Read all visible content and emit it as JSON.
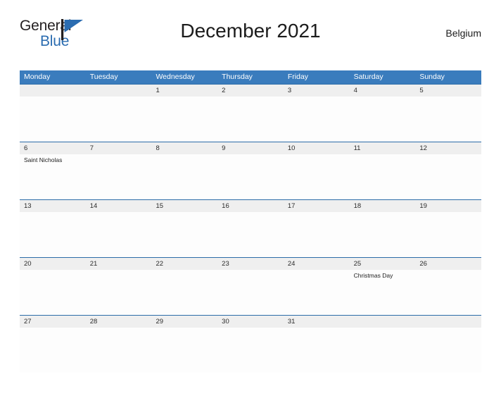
{
  "brand": {
    "name_part1": "General",
    "name_part2": "Blue",
    "mark_icon": "triangle-flag-icon",
    "mark_color": "#2b6cb0",
    "text_color": "#231f20"
  },
  "header": {
    "title": "December 2021",
    "region": "Belgium"
  },
  "colors": {
    "header_bar": "#3a7cbd",
    "date_band": "#efefef",
    "row_divider": "#2c6ca8",
    "accent_blue": "#2b6cb0",
    "text_dark": "#1c1c1c",
    "header_text": "#ffffff"
  },
  "calendar": {
    "weekdays": [
      "Monday",
      "Tuesday",
      "Wednesday",
      "Thursday",
      "Friday",
      "Saturday",
      "Sunday"
    ],
    "weeks": [
      {
        "days": [
          {
            "date": "",
            "event": ""
          },
          {
            "date": "",
            "event": ""
          },
          {
            "date": "1",
            "event": ""
          },
          {
            "date": "2",
            "event": ""
          },
          {
            "date": "3",
            "event": ""
          },
          {
            "date": "4",
            "event": ""
          },
          {
            "date": "5",
            "event": ""
          }
        ]
      },
      {
        "days": [
          {
            "date": "6",
            "event": "Saint Nicholas"
          },
          {
            "date": "7",
            "event": ""
          },
          {
            "date": "8",
            "event": ""
          },
          {
            "date": "9",
            "event": ""
          },
          {
            "date": "10",
            "event": ""
          },
          {
            "date": "11",
            "event": ""
          },
          {
            "date": "12",
            "event": ""
          }
        ]
      },
      {
        "days": [
          {
            "date": "13",
            "event": ""
          },
          {
            "date": "14",
            "event": ""
          },
          {
            "date": "15",
            "event": ""
          },
          {
            "date": "16",
            "event": ""
          },
          {
            "date": "17",
            "event": ""
          },
          {
            "date": "18",
            "event": ""
          },
          {
            "date": "19",
            "event": ""
          }
        ]
      },
      {
        "days": [
          {
            "date": "20",
            "event": ""
          },
          {
            "date": "21",
            "event": ""
          },
          {
            "date": "22",
            "event": ""
          },
          {
            "date": "23",
            "event": ""
          },
          {
            "date": "24",
            "event": ""
          },
          {
            "date": "25",
            "event": "Christmas Day"
          },
          {
            "date": "26",
            "event": ""
          }
        ]
      },
      {
        "days": [
          {
            "date": "27",
            "event": ""
          },
          {
            "date": "28",
            "event": ""
          },
          {
            "date": "29",
            "event": ""
          },
          {
            "date": "30",
            "event": ""
          },
          {
            "date": "31",
            "event": ""
          },
          {
            "date": "",
            "event": ""
          },
          {
            "date": "",
            "event": ""
          }
        ]
      }
    ]
  }
}
